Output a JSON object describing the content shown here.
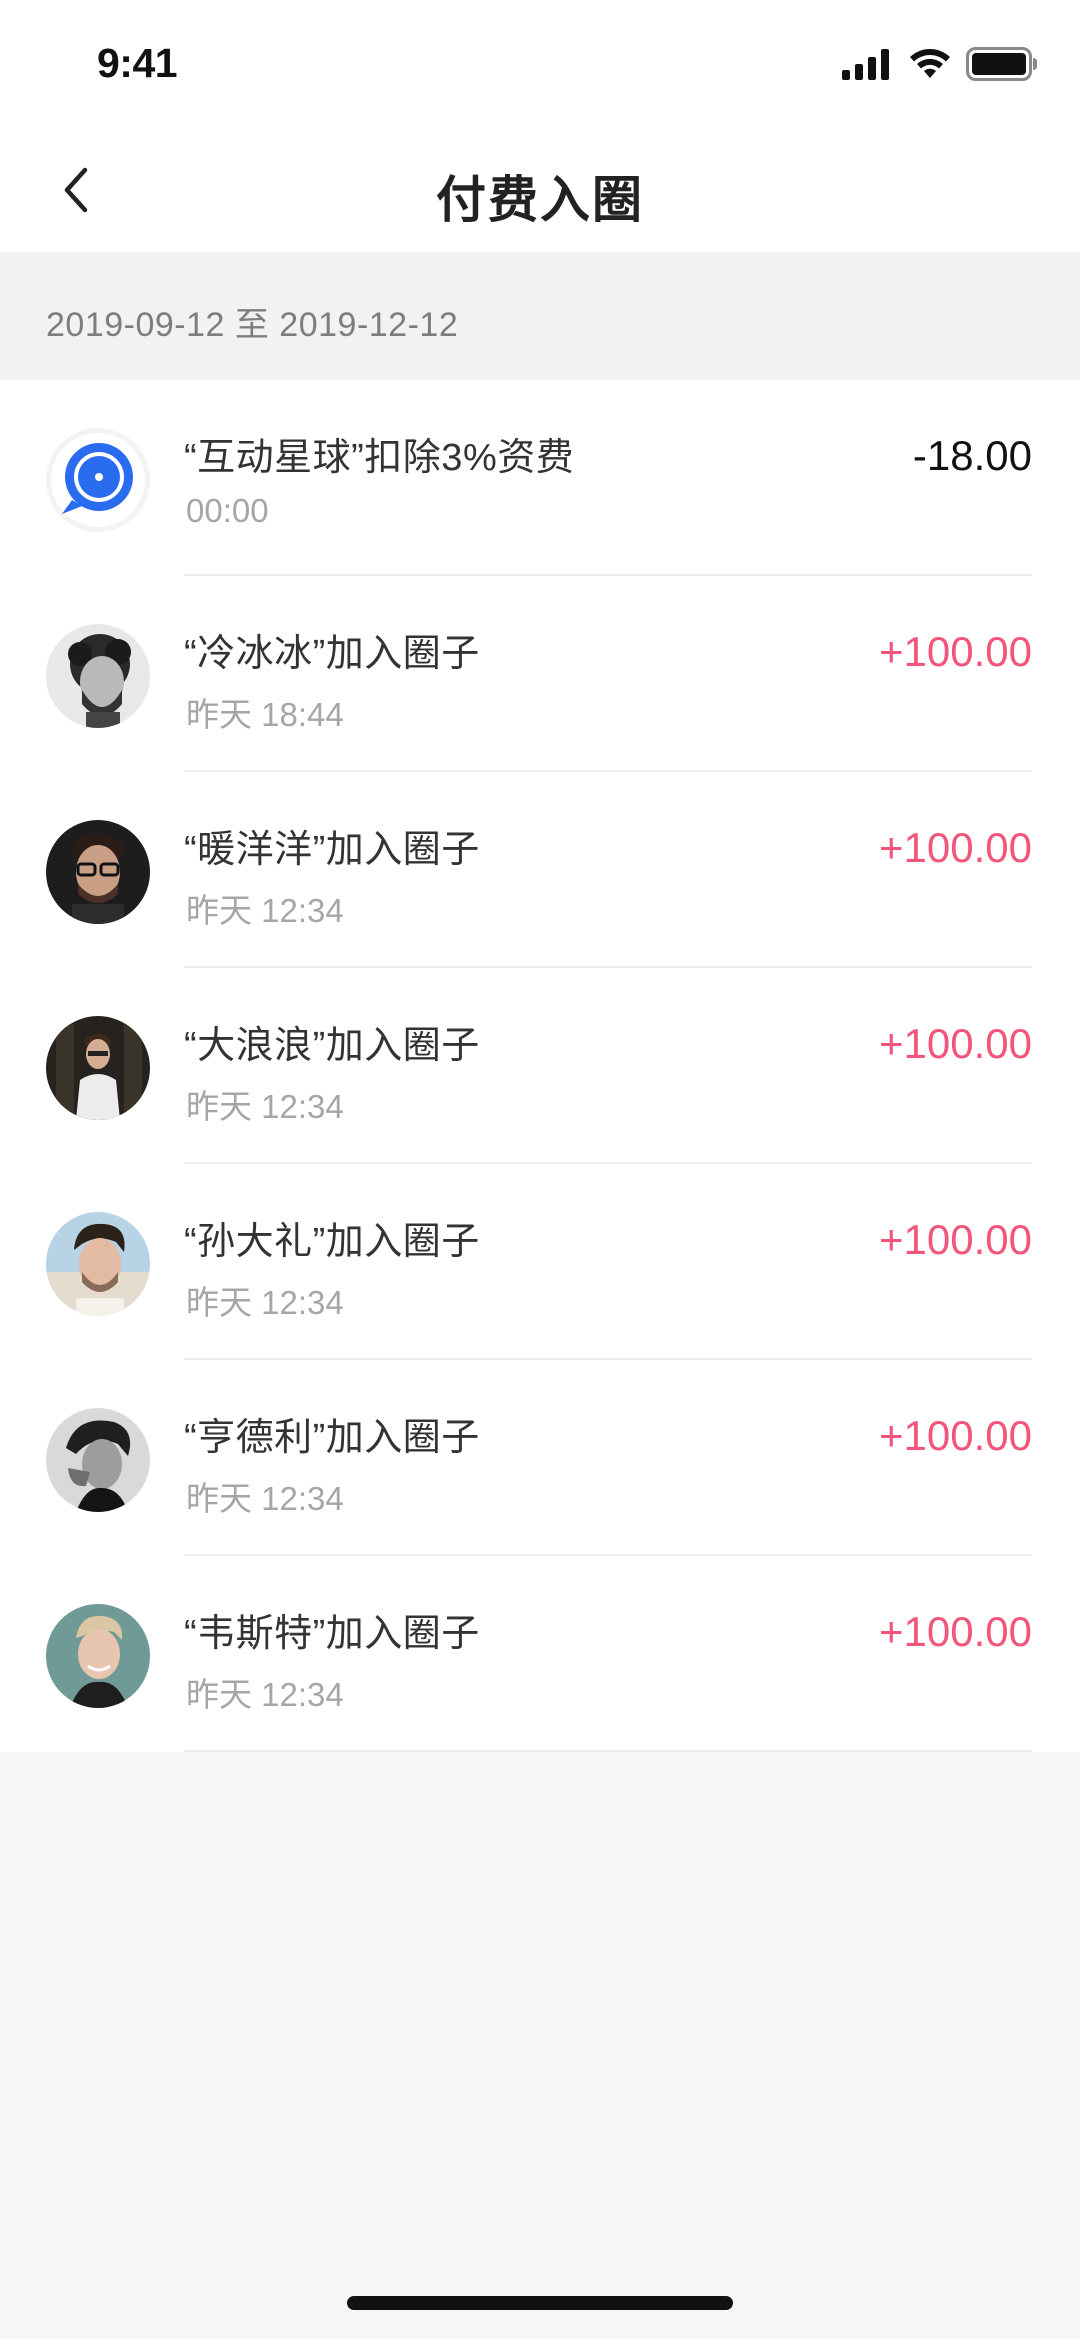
{
  "status_bar": {
    "time": "9:41"
  },
  "nav": {
    "title": "付费入圈"
  },
  "date_range": "2019-09-12 至 2019-12-12",
  "colors": {
    "income": "#f2547a",
    "expense": "#111111",
    "brand_blue": "#2a6cf0"
  },
  "transactions": [
    {
      "title": "“互动星球”扣除3%资费",
      "time": "00:00",
      "amount": "-18.00",
      "type": "expense",
      "avatar": "planet-logo"
    },
    {
      "title": "“冷冰冰”加入圈子",
      "time": "昨天 18:44",
      "amount": "+100.00",
      "type": "income",
      "avatar": "user-avatar"
    },
    {
      "title": "“暖洋洋”加入圈子",
      "time": "昨天 12:34",
      "amount": "+100.00",
      "type": "income",
      "avatar": "user-avatar"
    },
    {
      "title": "“大浪浪”加入圈子",
      "time": "昨天 12:34",
      "amount": "+100.00",
      "type": "income",
      "avatar": "user-avatar"
    },
    {
      "title": "“孙大礼”加入圈子",
      "time": "昨天 12:34",
      "amount": "+100.00",
      "type": "income",
      "avatar": "user-avatar"
    },
    {
      "title": "“亨德利”加入圈子",
      "time": "昨天 12:34",
      "amount": "+100.00",
      "type": "income",
      "avatar": "user-avatar"
    },
    {
      "title": "“韦斯特”加入圈子",
      "time": "昨天 12:34",
      "amount": "+100.00",
      "type": "income",
      "avatar": "user-avatar"
    }
  ]
}
